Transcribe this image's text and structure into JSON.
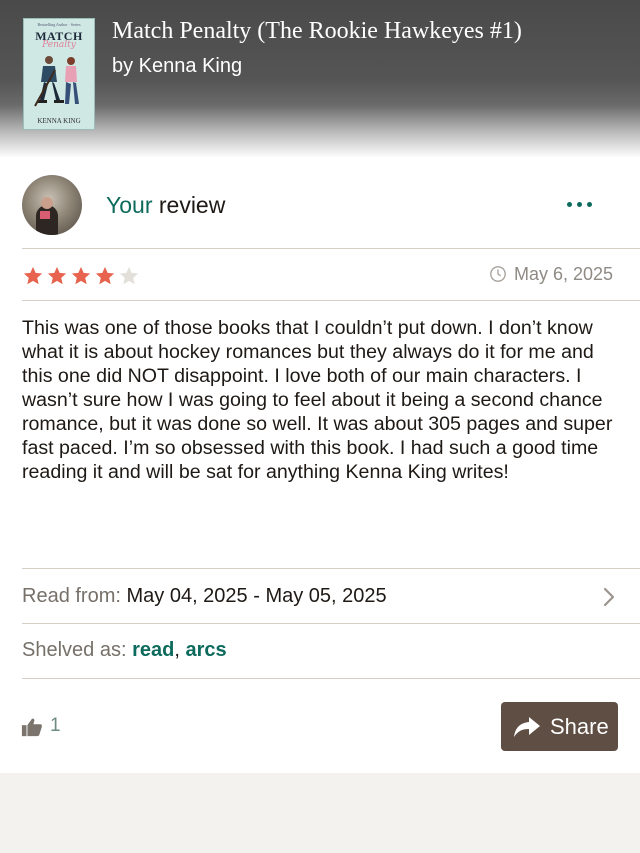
{
  "book": {
    "cover_top_text": "Bestselling Author · Series",
    "cover_title": "MATCH",
    "cover_subtitle": "Penalty",
    "cover_author": "KENNA KING",
    "title": "Match Penalty (The Rookie Hawkeyes #1)",
    "author": "by Kenna King"
  },
  "review": {
    "heading_your": "Your",
    "heading_review": " review",
    "rating": 4,
    "rating_max": 5,
    "date": "May 6, 2025",
    "text": "This was one of those books that I couldn’t put down. I don’t know what it is about hockey romances but they always do it for me and this one did NOT disappoint. I love both of our main characters. I wasn’t sure how I was going to feel about it being a second chance romance, but it was done so well. It was about 305 pages and super fast paced. I’m so obsessed with this book. I had such a good time reading it and will be sat for anything Kenna King writes!",
    "read_from_label": "Read from: ",
    "read_from_value": "May 04, 2025 - May 05, 2025",
    "shelved_label": "Shelved as: ",
    "shelf_1": "read",
    "shelf_sep": ", ",
    "shelf_2": "arcs",
    "likes": "1",
    "share_label": "Share"
  },
  "colors": {
    "accent_green": "#0d6b5d",
    "star_filled": "#e8634f",
    "star_empty": "#e3e0da",
    "share_button": "#5f4e43"
  },
  "icons": [
    "more-options-icon",
    "star-icon",
    "clock-icon",
    "chevron-right-icon",
    "thumbs-up-icon",
    "share-arrow-icon"
  ]
}
